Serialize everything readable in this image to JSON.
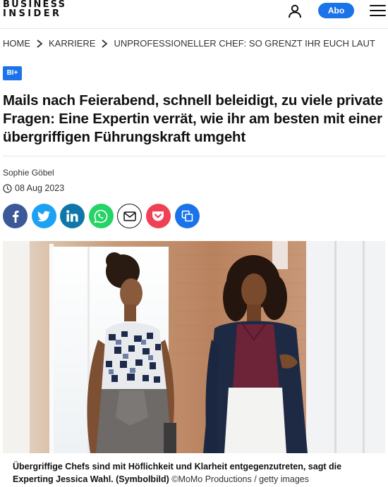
{
  "header": {
    "logo_line1": "BUSINESS",
    "logo_line2": "INSIDER",
    "abo_label": "Abo",
    "user_icon": "user-icon",
    "menu_icon": "hamburger-menu-icon"
  },
  "breadcrumb": {
    "items": [
      "HOME",
      "KARRIERE",
      "UNPROFESSIONELLER CHEF: SO GRENZT IHR EUCH LAUT"
    ]
  },
  "badge": "BI+",
  "article": {
    "headline": "Mails nach Feierabend, schnell beleidigt, zu viele private Fragen: Eine Expertin verrät, wie ihr am besten mit einer übergriffigen Führungskraft umgeht",
    "author": "Sophie Göbel",
    "date": "08 Aug 2023"
  },
  "share": [
    {
      "icon": "facebook-icon",
      "color": "#3b5998"
    },
    {
      "icon": "twitter-icon",
      "color": "#1da1f2"
    },
    {
      "icon": "linkedin-icon",
      "color": "#0e76a8"
    },
    {
      "icon": "whatsapp-icon",
      "color": "#25d366"
    },
    {
      "icon": "email-icon",
      "color": "#ffffff"
    },
    {
      "icon": "pocket-icon",
      "color": "#ef4056"
    },
    {
      "icon": "copy-link-icon",
      "color": "#1a73e8"
    }
  ],
  "caption": {
    "text": "Übergriffige Chefs sind mit Höflichkeit und Klarheit entgegenzutreten, sagt die Experting Jessica Wahl. (Symbolbild)",
    "credit": "©MoMo Productions / getty images"
  },
  "colors": {
    "accent": "#1a73e8",
    "text": "#111111"
  }
}
